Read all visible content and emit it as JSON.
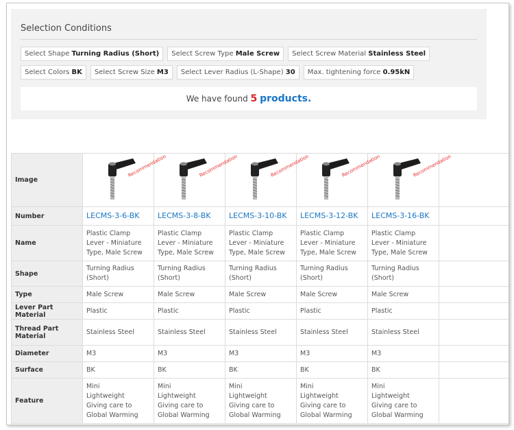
{
  "conditions": {
    "title": "Selection Conditions",
    "tags": [
      {
        "label": "Select Shape",
        "value": "Turning Radius (Short)"
      },
      {
        "label": "Select Screw Type",
        "value": "Male Screw"
      },
      {
        "label": "Select Screw Material",
        "value": "Stainless Steel"
      },
      {
        "label": "Select Colors",
        "value": "BK"
      },
      {
        "label": "Select Screw Size",
        "value": "M3"
      },
      {
        "label": "Select Lever Radius (L-Shape)",
        "value": "30"
      },
      {
        "label": "Max. tightening force",
        "value": "0.95kN"
      }
    ],
    "found_prefix": "We have found",
    "found_count": "5",
    "found_suffix": "products."
  },
  "table": {
    "row_labels": {
      "image": "Image",
      "number": "Number",
      "name": "Name",
      "shape": "Shape",
      "type": "Type",
      "lever": "Lever Part Material",
      "thread": "Thread Part Material",
      "diameter": "Diameter",
      "surface": "Surface",
      "feature": "Feature"
    },
    "recommendation": "Recommendation",
    "products": [
      {
        "number": "LECMS-3-6-BK",
        "name": "Plastic Clamp Lever - Miniature Type, Male Screw",
        "shape": "Turning Radius (Short)",
        "type": "Male Screw",
        "lever": "Plastic",
        "thread": "Stainless Steel",
        "diameter": "M3",
        "surface": "BK",
        "feature": [
          "Mini",
          "Lightweight",
          "Giving care to Global Warming"
        ]
      },
      {
        "number": "LECMS-3-8-BK",
        "name": "Plastic Clamp Lever - Miniature Type, Male Screw",
        "shape": "Turning Radius (Short)",
        "type": "Male Screw",
        "lever": "Plastic",
        "thread": "Stainless Steel",
        "diameter": "M3",
        "surface": "BK",
        "feature": [
          "Mini",
          "Lightweight",
          "Giving care to Global Warming"
        ]
      },
      {
        "number": "LECMS-3-10-BK",
        "name": "Plastic Clamp Lever - Miniature Type, Male Screw",
        "shape": "Turning Radius (Short)",
        "type": "Male Screw",
        "lever": "Plastic",
        "thread": "Stainless Steel",
        "diameter": "M3",
        "surface": "BK",
        "feature": [
          "Mini",
          "Lightweight",
          "Giving care to Global Warming"
        ]
      },
      {
        "number": "LECMS-3-12-BK",
        "name": "Plastic Clamp Lever - Miniature Type, Male Screw",
        "shape": "Turning Radius (Short)",
        "type": "Male Screw",
        "lever": "Plastic",
        "thread": "Stainless Steel",
        "diameter": "M3",
        "surface": "BK",
        "feature": [
          "Mini",
          "Lightweight",
          "Giving care to Global Warming"
        ]
      },
      {
        "number": "LECMS-3-16-BK",
        "name": "Plastic Clamp Lever - Miniature Type, Male Screw",
        "shape": "Turning Radius (Short)",
        "type": "Male Screw",
        "lever": "Plastic",
        "thread": "Stainless Steel",
        "diameter": "M3",
        "surface": "BK",
        "feature": [
          "Mini",
          "Lightweight",
          "Giving care to Global Warming"
        ]
      }
    ]
  },
  "colors": {
    "link": "#1a76c4",
    "count": "#d8232a",
    "header_bg": "#eeeeee",
    "panel_bg": "#f2f2f2"
  }
}
